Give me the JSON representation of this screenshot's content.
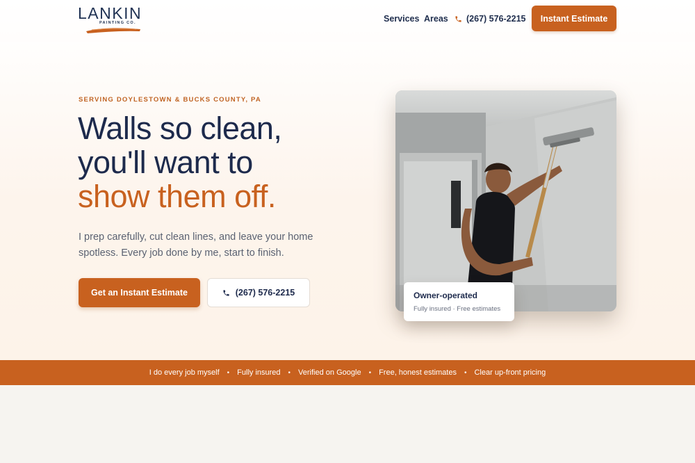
{
  "brand": {
    "name": "LANKIN",
    "tagline": "PAINTING CO.",
    "accent_color": "#c8611f",
    "navy_color": "#1d2a4c"
  },
  "nav": {
    "items": [
      {
        "label": "Services"
      },
      {
        "label": "Areas"
      }
    ],
    "phone": "(267) 576-2215",
    "phone_icon": "phone-icon",
    "cta_label": "Instant Estimate"
  },
  "hero": {
    "eyebrow": "SERVING DOYLESTOWN & BUCKS COUNTY, PA",
    "headline_line1": "Walls so clean,",
    "headline_line2": "you'll want to",
    "headline_accent": "show them off.",
    "lede": "I prep carefully, cut clean lines, and leave your home spotless. Every job done by me, start to finish.",
    "primary_cta": "Get an Instant Estimate",
    "secondary_cta": "(267) 576-2215"
  },
  "badge": {
    "title": "Owner-operated",
    "subtitle": "Fully insured · Free estimates"
  },
  "trust_strip": {
    "items": [
      "I do every job myself",
      "Fully insured",
      "Verified on Google",
      "Free, honest estimates",
      "Clear up-front pricing"
    ],
    "separator": "•"
  }
}
